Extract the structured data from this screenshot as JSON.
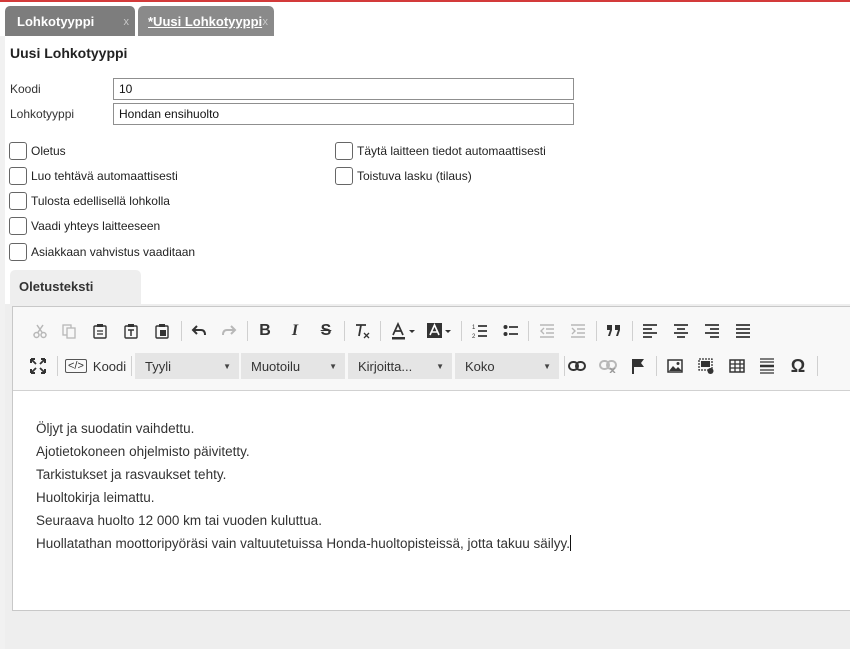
{
  "tabs": [
    {
      "label": "Lohkotyyppi",
      "close": "x"
    },
    {
      "label": "*Uusi Lohkotyyppi",
      "close": "x"
    }
  ],
  "form": {
    "title": "Uusi Lohkotyyppi",
    "fields": [
      {
        "label": "Koodi",
        "value": "10"
      },
      {
        "label": "Lohkotyyppi",
        "value": "Hondan ensihuolto"
      }
    ],
    "checkboxes_left": [
      {
        "label": "Oletus",
        "checked": false
      },
      {
        "label": "Luo tehtävä automaattisesti",
        "checked": false
      },
      {
        "label": "Tulosta edellisellä lohkolla",
        "checked": false
      },
      {
        "label": "Vaadi yhteys laitteeseen",
        "checked": false
      },
      {
        "label": "Asiakkaan vahvistus vaaditaan",
        "checked": false
      }
    ],
    "checkboxes_right": [
      {
        "label": "Täytä laitteen tiedot automaattisesti",
        "checked": false
      },
      {
        "label": "Toistuva lasku (tilaus)",
        "checked": false
      }
    ]
  },
  "section": {
    "tab_label": "Oletusteksti"
  },
  "editor": {
    "source_label": "Koodi",
    "combos": [
      {
        "label": "Tyyli"
      },
      {
        "label": "Muotoilu"
      },
      {
        "label": "Kirjoitta..."
      },
      {
        "label": "Koko"
      }
    ],
    "lines": [
      "Öljyt ja suodatin vaihdettu.",
      "Ajotietokoneen ohjelmisto päivitetty.",
      "Tarkistukset ja rasvaukset tehty.",
      "Huoltokirja leimattu.",
      "Seuraava huolto 12 000 km tai vuoden kuluttua.",
      "Huollatathan moottoripyöräsi vain valtuutetuissa Honda-huoltopisteissä, jotta takuu säilyy."
    ]
  },
  "colors": {
    "accent_line": "#d33a3a",
    "tab_bg": "#7d7d7d"
  }
}
